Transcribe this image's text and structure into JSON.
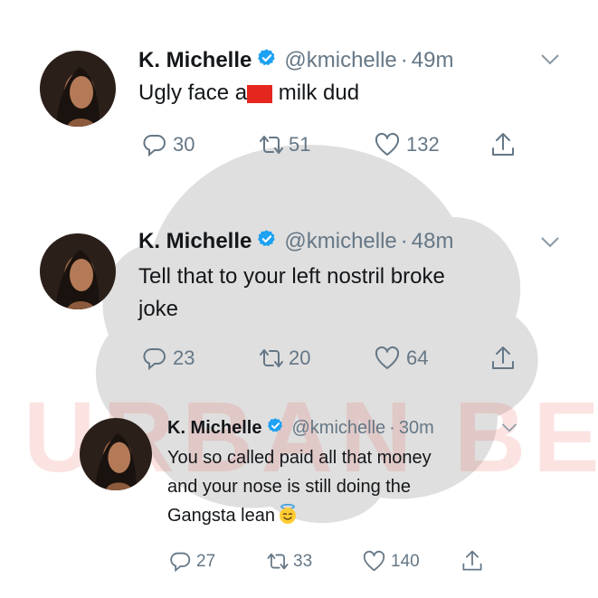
{
  "watermark": {
    "text": "URBAN BELLE"
  },
  "tweets": [
    {
      "name": "K. Michelle",
      "handle": "@kmichelle",
      "separator": "·",
      "time": "49m",
      "text_before": "Ugly face a",
      "text_after": " milk dud",
      "replies": "30",
      "retweets": "51",
      "likes": "132"
    },
    {
      "name": "K. Michelle",
      "handle": "@kmichelle",
      "separator": "·",
      "time": "48m",
      "line1": "Tell that to your left nostril broke",
      "line2": "joke",
      "replies": "23",
      "retweets": "20",
      "likes": "64"
    },
    {
      "name": "K. Michelle",
      "handle": "@kmichelle",
      "separator": "·",
      "time": "30m",
      "line1": "You so called paid all that money",
      "line2": "and your nose is still doing the",
      "line3": "Gangsta lean",
      "replies": "27",
      "retweets": "33",
      "likes": "140"
    }
  ],
  "icons": {
    "reply": "reply-icon",
    "retweet": "retweet-icon",
    "like": "heart-icon",
    "share": "share-icon",
    "verified": "verified-badge-icon",
    "caret": "chevron-down-icon",
    "emoji": "smiling-face-with-halo-emoji"
  },
  "colors": {
    "verified": "#1da1f2",
    "text": "#14171a",
    "muted": "#657786",
    "redaction": "#e5261f",
    "watermark": "#e8322c"
  }
}
